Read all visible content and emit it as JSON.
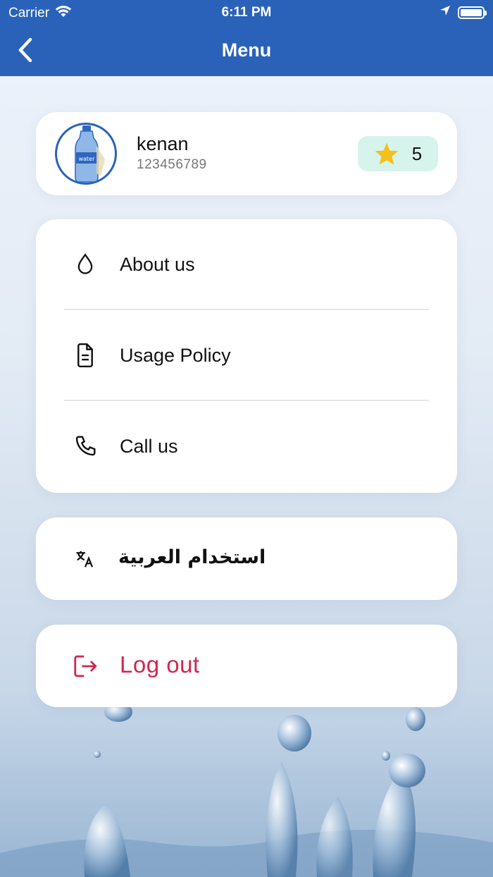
{
  "status_bar": {
    "carrier": "Carrier",
    "time": "6:11 PM"
  },
  "nav": {
    "title": "Menu"
  },
  "profile": {
    "name": "kenan",
    "phone": "123456789",
    "points": "5"
  },
  "menu": {
    "items": [
      {
        "label": "About us",
        "icon": "water-drop-icon"
      },
      {
        "label": "Usage Policy",
        "icon": "document-icon"
      },
      {
        "label": "Call us",
        "icon": "phone-icon"
      }
    ]
  },
  "language": {
    "label": "استخدام العربية",
    "icon": "translate-icon"
  },
  "logout": {
    "label": "Log out",
    "icon": "logout-icon"
  },
  "colors": {
    "header": "#2a62b9",
    "accent": "#d1264f",
    "badge_bg": "#d6f4ec",
    "star": "#f5c01a"
  }
}
